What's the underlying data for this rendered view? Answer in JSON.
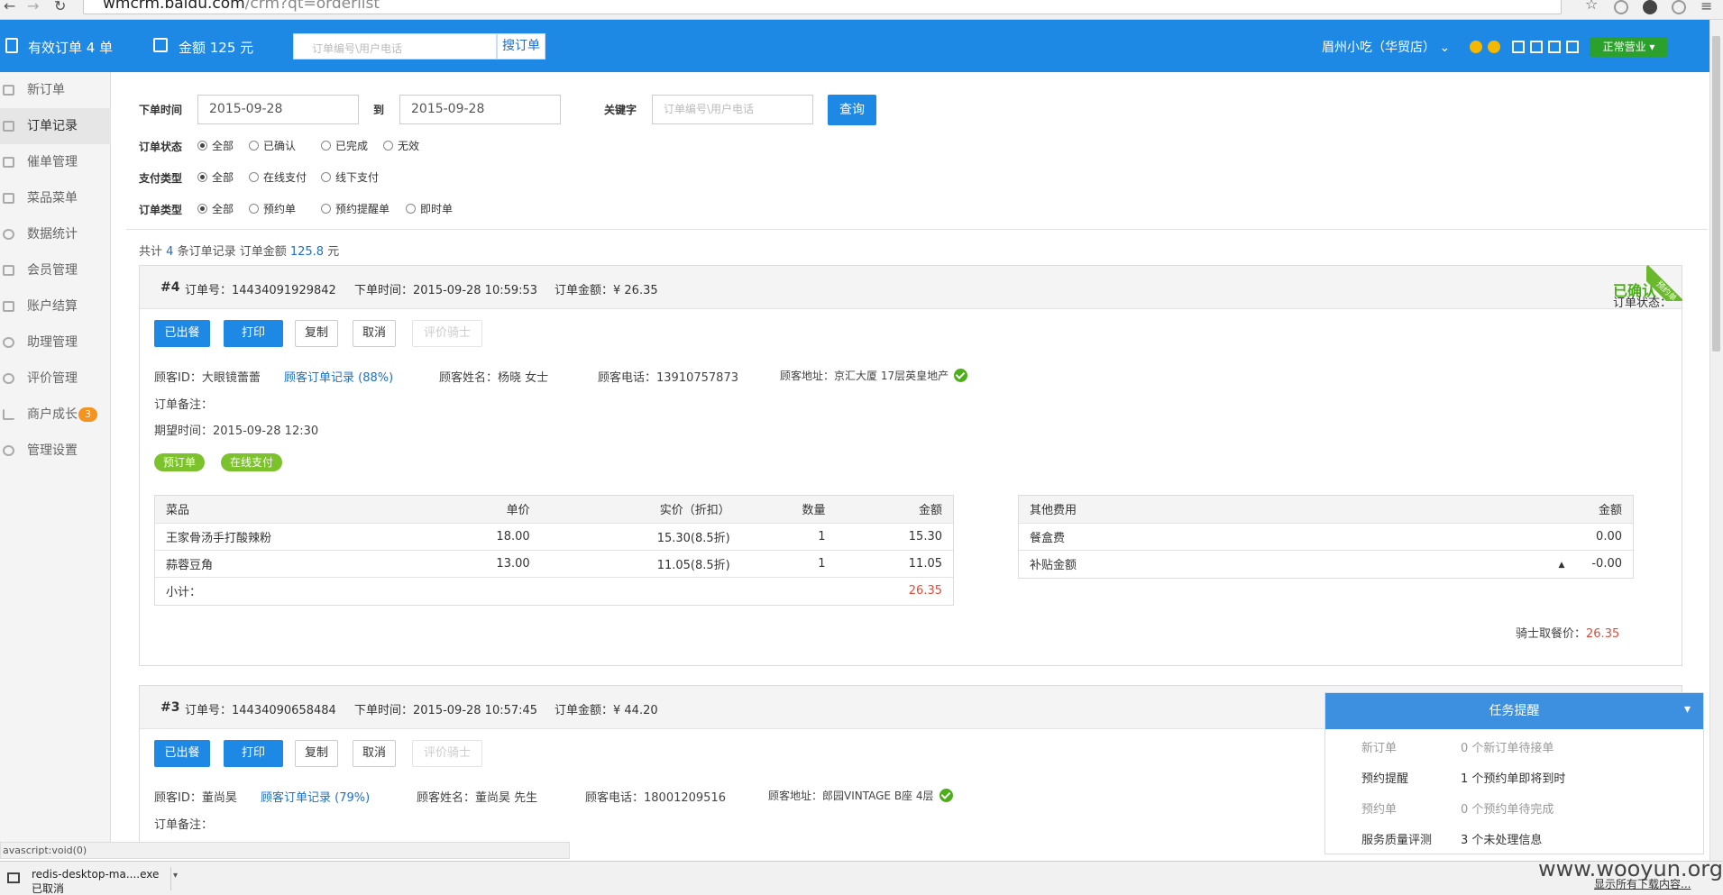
{
  "browser": {
    "url_host": "wmcrm.baidu.com",
    "url_path": "/crm?qt=orderlist"
  },
  "header": {
    "valid_orders": "有效订单 4 单",
    "amount": "金额 125 元",
    "search_placeholder": "订单编号\\用户电话",
    "search_button": "搜订单",
    "store_name": "眉州小吃（华贸店）",
    "status_button": "正常营业"
  },
  "sidebar": {
    "items": [
      {
        "label": "新订单"
      },
      {
        "label": "订单记录"
      },
      {
        "label": "催单管理"
      },
      {
        "label": "菜品菜单"
      },
      {
        "label": "数据统计"
      },
      {
        "label": "会员管理"
      },
      {
        "label": "账户结算"
      },
      {
        "label": "助理管理"
      },
      {
        "label": "评价管理"
      },
      {
        "label": "商户成长",
        "badge": "3"
      },
      {
        "label": "管理设置"
      }
    ]
  },
  "filter": {
    "time_label": "下单时间",
    "date_from": "2015-09-28",
    "to_label": "到",
    "date_to": "2015-09-28",
    "keyword_label": "关键字",
    "keyword_placeholder": "订单编号\\用户电话",
    "query_button": "查询",
    "status_label": "订单状态",
    "status_options": [
      "全部",
      "已确认",
      "已完成",
      "无效"
    ],
    "pay_label": "支付类型",
    "pay_options": [
      "全部",
      "在线支付",
      "线下支付"
    ],
    "type_label": "订单类型",
    "type_options": [
      "全部",
      "预约单",
      "预约提醒单",
      "即时单"
    ]
  },
  "summary": {
    "prefix": "共计",
    "count": "4",
    "middle": "条订单记录 订单金额",
    "amount": "125.8",
    "suffix": "元"
  },
  "orders": [
    {
      "num": "#4",
      "order_no": "订单号：14434091929842",
      "order_time": "下单时间：2015-09-28 10:59:53",
      "order_amount": "订单金额：¥ 26.35",
      "status_label": "订单状态：",
      "status": "已确认",
      "ribbon": "预约单",
      "buttons": [
        "已出餐",
        "打印",
        "复制",
        "取消",
        "评价骑士"
      ],
      "customer_id": "顾客ID：大眼镜蕾蕾",
      "customer_history": "顾客订单记录 (88%)",
      "customer_name": "顾客姓名：杨晓 女士",
      "customer_phone": "顾客电话：13910757873",
      "customer_address": "顾客地址：京汇大厦 17层英皇地产",
      "remark": "订单备注：",
      "expect_time": "期望时间：2015-09-28 12:30",
      "tags": [
        "预订单",
        "在线支付"
      ],
      "items_header": [
        "菜品",
        "单价",
        "实价（折扣）",
        "数量",
        "金额"
      ],
      "items": [
        [
          "王家骨汤手打酸辣粉",
          "18.00",
          "15.30(8.5折)",
          "1",
          "15.30"
        ],
        [
          "蒜蓉豆角",
          "13.00",
          "11.05(8.5折)",
          "1",
          "11.05"
        ]
      ],
      "subtotal_label": "小计：",
      "subtotal": "26.35",
      "fees_header": [
        "其他费用",
        "金额"
      ],
      "fees": [
        [
          "餐盒费",
          "0.00"
        ],
        [
          "补贴金额",
          "-0.00"
        ]
      ],
      "rider_label": "骑士取餐价：",
      "rider_price": "26.35"
    },
    {
      "num": "#3",
      "order_no": "订单号：14434090658484",
      "order_time": "下单时间：2015-09-28 10:57:45",
      "order_amount": "订单金额：¥ 44.20",
      "buttons": [
        "已出餐",
        "打印",
        "复制",
        "取消",
        "评价骑士"
      ],
      "customer_id": "顾客ID：董尚昊",
      "customer_history": "顾客订单记录 (79%)",
      "customer_name": "顾客姓名：董尚昊 先生",
      "customer_phone": "顾客电话：18001209516",
      "customer_address": "顾客地址：郎园VINTAGE B座 4层",
      "remark": "订单备注："
    }
  ],
  "task_popup": {
    "title": "任务提醒",
    "rows": [
      {
        "k": "新订单",
        "v": "0 个新订单待接单"
      },
      {
        "k": "预约提醒",
        "v": "1 个预约单即将到时"
      },
      {
        "k": "预约单",
        "v": "0 个预约单待完成"
      },
      {
        "k": "服务质量评测",
        "v": "3 个未处理信息"
      }
    ]
  },
  "statusbar": {
    "url": "avascript:void(0)"
  },
  "download": {
    "file": "redis-desktop-ma....exe",
    "state": "已取消",
    "show_all": "显示所有下载内容..."
  },
  "watermark": "www.wooyun.org"
}
